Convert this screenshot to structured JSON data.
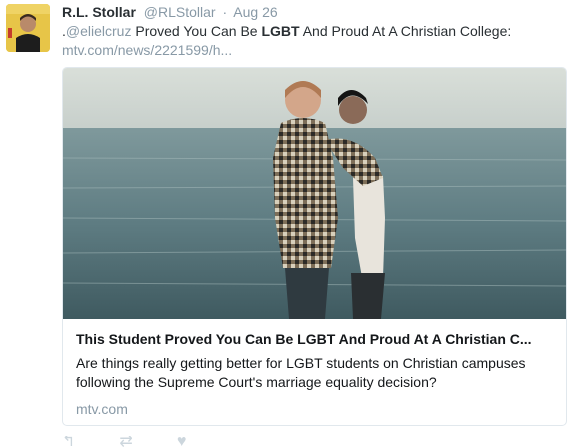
{
  "tweet": {
    "author_name": "R.L. Stollar",
    "author_handle": "@RLStollar",
    "separator": "·",
    "timestamp": "Aug 26",
    "mention_prefix": ".",
    "mention": "@elielcruz",
    "text_before": " Proved You Can Be ",
    "text_highlight": "LGBT",
    "text_after": " And Proud At A Christian College:",
    "link": "mtv.com/news/2221599/h..."
  },
  "card": {
    "title": "This Student Proved You Can Be LGBT And Proud At A Christian C...",
    "description": "Are things really getting better for LGBT students on Christian campuses following the Supreme Court's marriage equality decision?",
    "domain": "mtv.com"
  },
  "actions": {
    "reply_icon": "reply-icon",
    "retweet_icon": "retweet-icon",
    "like_icon": "like-icon"
  },
  "colors": {
    "muted": "#8899a6",
    "text": "#292f33",
    "border": "#e1e8ed",
    "avatar_bg": "#e9c94a"
  }
}
